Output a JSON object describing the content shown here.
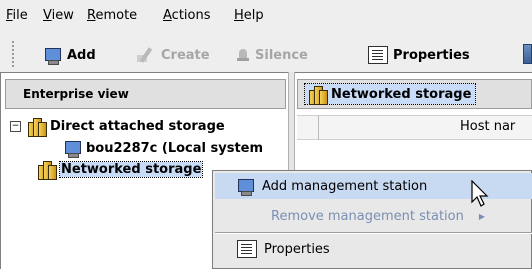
{
  "menubar": {
    "items": [
      {
        "label": "File",
        "underline": "F",
        "rest": "ile"
      },
      {
        "label": "View",
        "underline": "V",
        "rest": "iew"
      },
      {
        "label": "Remote",
        "underline": "R",
        "rest": "emote"
      },
      {
        "label": "Actions",
        "underline": "A",
        "rest": "ctions"
      },
      {
        "label": "Help",
        "underline": "H",
        "rest": "elp"
      }
    ]
  },
  "toolbar": {
    "add": "Add",
    "create": "Create",
    "silence": "Silence",
    "properties": "Properties"
  },
  "left_panel": {
    "header": "Enterprise view",
    "tree": [
      {
        "label": "Direct attached storage",
        "expander": "−",
        "icon": "storage-icon"
      },
      {
        "label": "bou2287c (Local system",
        "icon": "monitor-icon"
      },
      {
        "label": "Networked storage",
        "icon": "storage-icon",
        "selected": true
      }
    ]
  },
  "right_panel": {
    "title": "Networked storage",
    "column_header": "Host nar"
  },
  "context_menu": {
    "items": [
      {
        "label": "Add management station",
        "icon": "monitor-icon",
        "highlighted": true
      },
      {
        "label": "Remove management station",
        "submenu": true,
        "disabled": true
      },
      {
        "label": "Properties",
        "icon": "document-icon"
      }
    ]
  },
  "colors": {
    "selection": "#c8dbf7",
    "menu_highlight": "#c8d9f2",
    "header_bg": "#e0e0e0"
  }
}
